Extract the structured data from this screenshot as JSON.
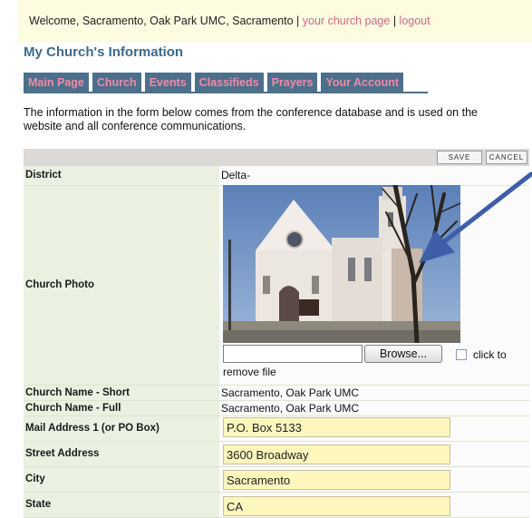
{
  "header": {
    "welcome_text": "Welcome, Sacramento, Oak Park UMC, Sacramento",
    "sep1": " | ",
    "church_page_link": "your church page",
    "sep2": " | ",
    "logout_link": "logout"
  },
  "page_title": "My Church's Information",
  "tabs": [
    {
      "label": "Main Page"
    },
    {
      "label": "Church"
    },
    {
      "label": "Events"
    },
    {
      "label": "Classifieds"
    },
    {
      "label": "Prayers"
    },
    {
      "label": "Your Account"
    }
  ],
  "intro_text": "The information in the form below comes from the conference database and is used on the website and all conference communications.",
  "toolbar": {
    "save_label": "SAVE",
    "cancel_label": "CANCEL"
  },
  "rows": {
    "district": {
      "label": "District",
      "value": "Delta-"
    },
    "photo": {
      "label": "Church Photo",
      "browse_label": "Browse...",
      "click_to": "click to",
      "remove_file": "remove file"
    },
    "name_short": {
      "label": "Church Name - Short",
      "value": "Sacramento, Oak Park UMC"
    },
    "name_full": {
      "label": "Church Name - Full",
      "value": "Sacramento, Oak Park UMC"
    },
    "mail_address": {
      "label": "Mail Address 1 (or PO Box)",
      "value": "P.O. Box 5133"
    },
    "street_address": {
      "label": "Street Address",
      "value": "3600 Broadway"
    },
    "city": {
      "label": "City",
      "value": "Sacramento"
    },
    "state": {
      "label": "State",
      "value": "CA"
    }
  },
  "colors": {
    "tab_bg": "#4c6f8c",
    "tab_text": "#f08aa8",
    "link": "#d06a8a",
    "title": "#3d6a8e",
    "label_bg": "#eaf1e1",
    "input_bg": "#fdf6bd",
    "arrow": "#3e5ea8"
  }
}
